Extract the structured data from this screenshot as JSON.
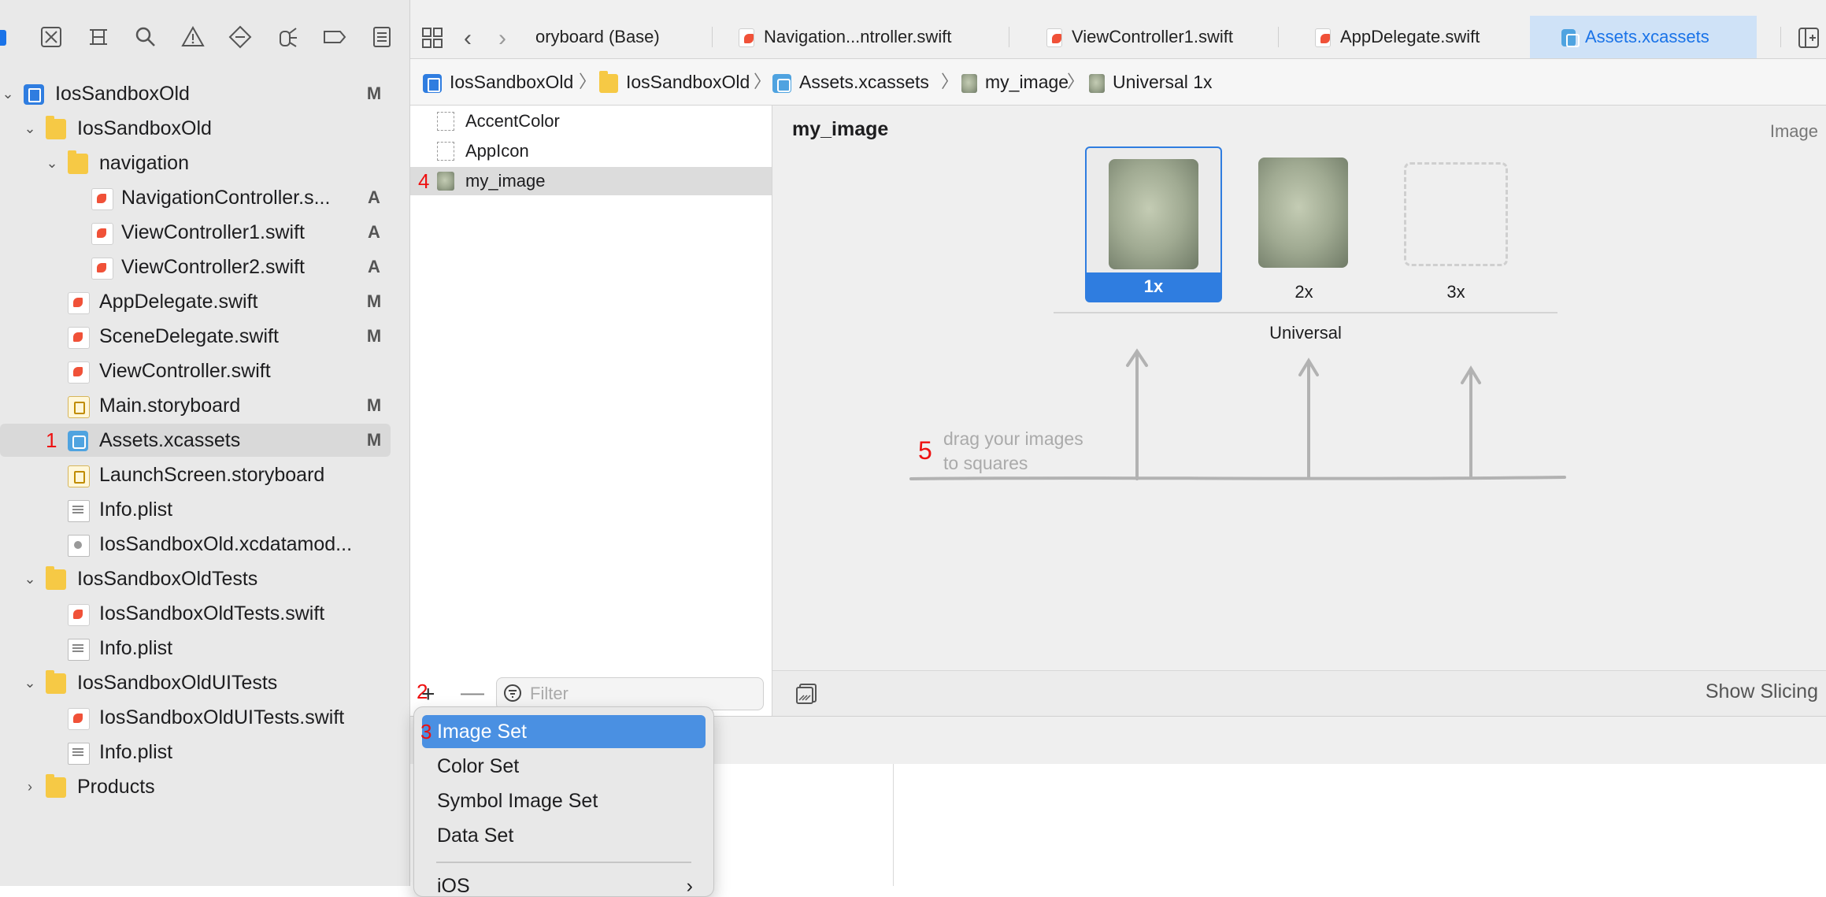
{
  "tabs": [
    {
      "label": "oryboard (Base)"
    },
    {
      "label": "Navigation...ntroller.swift"
    },
    {
      "label": "ViewController1.swift"
    },
    {
      "label": "AppDelegate.swift"
    },
    {
      "label": "Assets.xcassets"
    }
  ],
  "breadcrumb": [
    "IosSandboxOld",
    "IosSandboxOld",
    "Assets.xcassets",
    "my_image",
    "Universal 1x"
  ],
  "tree": [
    {
      "label": "IosSandboxOld",
      "badge": "M",
      "icon": "project-icon"
    },
    {
      "label": "IosSandboxOld",
      "badge": "",
      "icon": "folder-icon"
    },
    {
      "label": "navigation",
      "badge": "",
      "icon": "folder-icon"
    },
    {
      "label": "NavigationController.s...",
      "badge": "A",
      "icon": "swift-file-icon"
    },
    {
      "label": "ViewController1.swift",
      "badge": "A",
      "icon": "swift-file-icon"
    },
    {
      "label": "ViewController2.swift",
      "badge": "A",
      "icon": "swift-file-icon"
    },
    {
      "label": "AppDelegate.swift",
      "badge": "M",
      "icon": "swift-file-icon"
    },
    {
      "label": "SceneDelegate.swift",
      "badge": "M",
      "icon": "swift-file-icon"
    },
    {
      "label": "ViewController.swift",
      "badge": "",
      "icon": "swift-file-icon"
    },
    {
      "label": "Main.storyboard",
      "badge": "M",
      "icon": "storyboard-icon"
    },
    {
      "label": "Assets.xcassets",
      "badge": "M",
      "icon": "asset-catalog-icon"
    },
    {
      "label": "LaunchScreen.storyboard",
      "badge": "",
      "icon": "storyboard-icon"
    },
    {
      "label": "Info.plist",
      "badge": "",
      "icon": "plist-icon"
    },
    {
      "label": "IosSandboxOld.xcdatamod...",
      "badge": "",
      "icon": "datamodel-icon"
    },
    {
      "label": "IosSandboxOldTests",
      "badge": "",
      "icon": "folder-icon"
    },
    {
      "label": "IosSandboxOldTests.swift",
      "badge": "",
      "icon": "swift-file-icon"
    },
    {
      "label": "Info.plist",
      "badge": "",
      "icon": "plist-icon"
    },
    {
      "label": "IosSandboxOldUITests",
      "badge": "",
      "icon": "folder-icon"
    },
    {
      "label": "IosSandboxOldUITests.swift",
      "badge": "",
      "icon": "swift-file-icon"
    },
    {
      "label": "Info.plist",
      "badge": "",
      "icon": "plist-icon"
    },
    {
      "label": "Products",
      "badge": "",
      "icon": "folder-icon"
    }
  ],
  "annotations": {
    "n1": "1",
    "n2": "2",
    "n3": "3",
    "n4": "4",
    "n5": "5"
  },
  "assets": [
    {
      "label": "AccentColor"
    },
    {
      "label": "AppIcon"
    },
    {
      "label": "my_image"
    }
  ],
  "filter_placeholder": "Filter",
  "detail": {
    "title": "my_image",
    "type_label": "Image",
    "slots": [
      "1x",
      "2x",
      "3x"
    ],
    "universal_label": "Universal",
    "drag_hint_line1": "drag your images",
    "drag_hint_line2": "to squares",
    "show_slicing": "Show Slicing"
  },
  "menu": {
    "items": [
      "Image Set",
      "Color Set",
      "Symbol Image Set",
      "Data Set",
      "iOS"
    ]
  },
  "colors": {
    "accent": "#2f7de0",
    "selection": "#d9d9d9",
    "menu_highlight": "#4a90e2",
    "annotation": "#e11111"
  }
}
